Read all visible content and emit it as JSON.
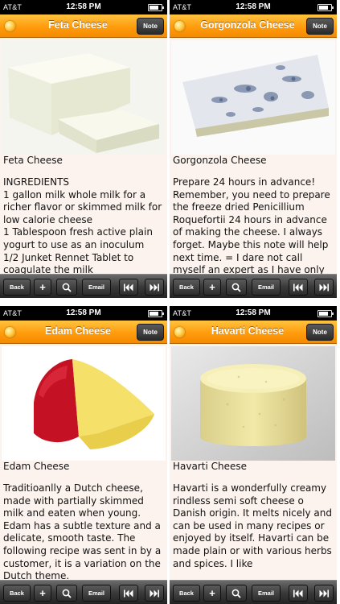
{
  "status": {
    "carrier": "AT&T",
    "time": "12:58 PM"
  },
  "toolbar": {
    "back": "Back",
    "add": "+",
    "email": "Email"
  },
  "note_label": "Note",
  "screens": [
    {
      "title": "Feta Cheese",
      "caption": "Feta Cheese",
      "body": "INGREDIENTS\n1 gallon milk whole milk for a richer flavor or skimmed milk for low calorie cheese\n1 Tablespoon fresh active plain yogurt to use as an inoculum\n1/2 Junket Rennet Tablet to coagulate the milk"
    },
    {
      "title": "Gorgonzola Cheese",
      "caption": "Gorgonzola Cheese",
      "body": "Prepare 24 hours in advance! Remember, you need to prepare the freeze dried Penicillium Roquefortii 24 hours in advance of making the cheese. I always forget. Maybe this note will help next time. = I dare not call myself an expert as I have only made one"
    },
    {
      "title": "Edam Cheese",
      "caption": "Edam Cheese",
      "body": "Traditioanlly a Dutch cheese, made with partially skimmed milk and eaten when young. Edam has a subtle texture and a delicate, smooth taste. The following recipe was sent in by a customer, it is a variation on the Dutch theme.\n\nIngredients"
    },
    {
      "title": "Havarti Cheese",
      "caption": "Havarti Cheese",
      "body": "Havarti is a wonderfully creamy rindless semi soft cheese o Danish origin. It melts nicely and can be used in many recipes or enjoyed by itself. Havarti can be made plain or with various herbs and spices. I like"
    }
  ]
}
